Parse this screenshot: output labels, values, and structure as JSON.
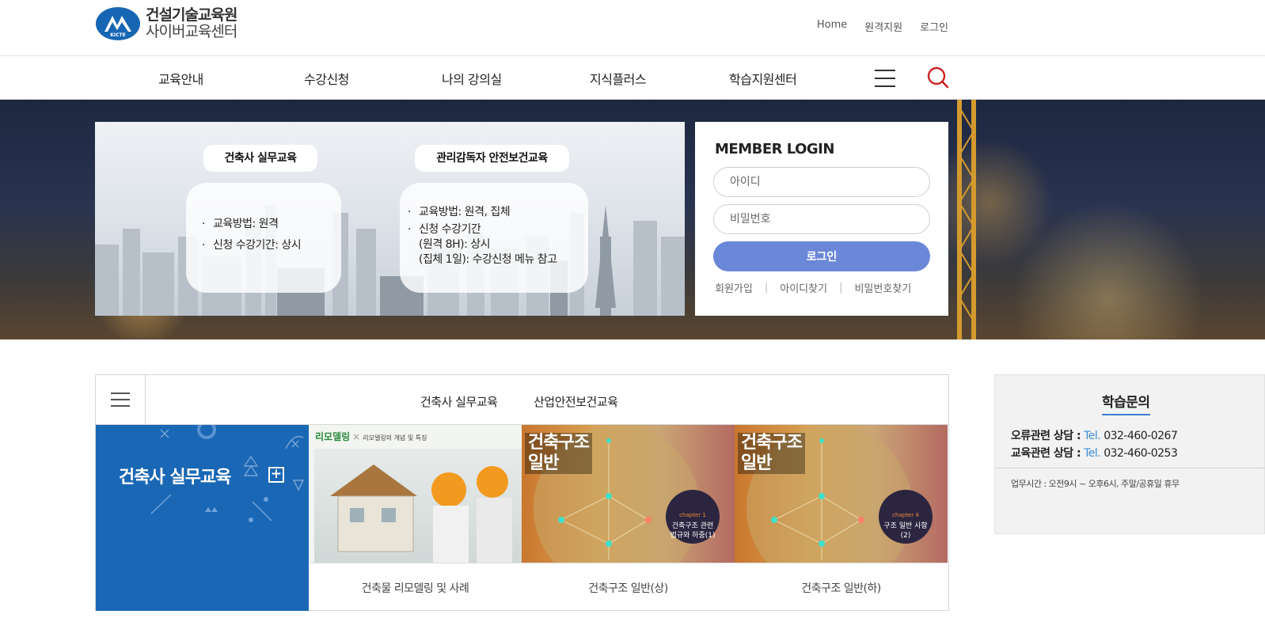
{
  "header": {
    "logo_line1": "건설기술교육원",
    "logo_line2": "사이버교육센터",
    "util_links": [
      "Home",
      "원격지원",
      "로그인"
    ]
  },
  "nav": {
    "items": [
      "교육안내",
      "수강신청",
      "나의 강의실",
      "지식플러스",
      "학습지원센터"
    ]
  },
  "hero": {
    "card1": {
      "title": "건축사 실무교육",
      "lines": [
        "교육방법: 원격",
        "신청 수강기간: 상시"
      ]
    },
    "card2": {
      "title": "관리감독자 안전보건교육",
      "lines": [
        "교육방법: 원격, 집체",
        "신청 수강기간",
        "(원격 8H): 상시",
        "(집체 1일): 수강신청 메뉴 참고"
      ]
    }
  },
  "login": {
    "title": "MEMBER LOGIN",
    "id_placeholder": "아이디",
    "pw_placeholder": "비밀번호",
    "button": "로그인",
    "links": [
      "회원가입",
      "아이디찾기",
      "비밀번호찾기"
    ],
    "separator": "|"
  },
  "courses": {
    "tabs": [
      "건축사 실무교육",
      "산업안전보건교육"
    ],
    "feature_title": "건축사 실무교육",
    "feature_plus": "+",
    "items": [
      {
        "label": "건축물 리모델링 및 사례",
        "thumb_head": "리모델링",
        "thumb_sub": "리모델링의 개념 및 특징"
      },
      {
        "label": "건축구조 일반(상)",
        "thumb_title": "건축구조\n일반",
        "badge_chapter": "chapter 1",
        "badge_text": "건축구조 관련\n법규와 하중(1)"
      },
      {
        "label": "건축구조 일반(하)",
        "thumb_title": "건축구조\n일반",
        "badge_chapter": "chapter 4",
        "badge_text": "구조 일반 사항\n(2)"
      }
    ]
  },
  "inquiry": {
    "title": "학습문의",
    "lines": [
      {
        "key": "오류관련 상담 :",
        "tel_label": "Tel.",
        "number": "032-460-0267"
      },
      {
        "key": "교육관련 상담 :",
        "tel_label": "Tel.",
        "number": "032-460-0253"
      }
    ],
    "hours": "업무시간 : 오전9시 ~ 오후6시, 주말/공휴일 휴무"
  },
  "colors": {
    "accent_blue": "#1a67b5",
    "login_button": "#6b87d8",
    "tel_blue": "#3f8ed8",
    "search_red": "#cc2222"
  }
}
